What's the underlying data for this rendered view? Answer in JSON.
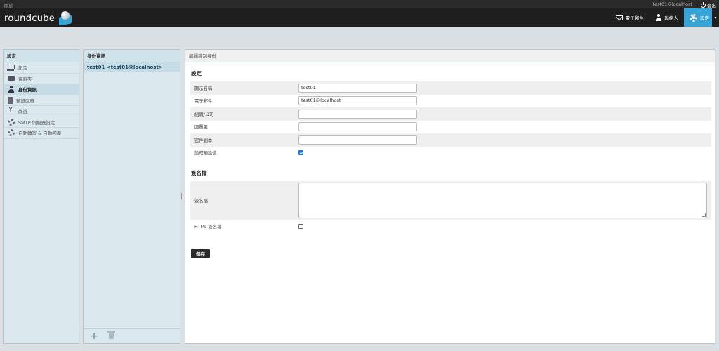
{
  "topbar": {
    "about": "關於",
    "user": "test01@localhost",
    "logout": "登出"
  },
  "header": {
    "logo_text": "roundcube",
    "nav": [
      {
        "label": "電子郵件",
        "icon": "mail-icon"
      },
      {
        "label": "聯絡人",
        "icon": "contacts-icon"
      },
      {
        "label": "設定",
        "icon": "gear-icon",
        "active": true
      }
    ],
    "accent": "#37a4d8"
  },
  "settings_panel": {
    "title": "設定",
    "items": [
      {
        "label": "設定",
        "icon": "monitor-icon"
      },
      {
        "label": "資料夾",
        "icon": "folder-icon"
      },
      {
        "label": "身份資訊",
        "icon": "user-icon",
        "selected": true
      },
      {
        "label": "預設回應",
        "icon": "document-icon"
      },
      {
        "label": "篩選",
        "icon": "filter-icon"
      },
      {
        "label": "SMTP 伺服器設定",
        "icon": "gear-icon"
      },
      {
        "label": "自動轉寄 & 自動回覆",
        "icon": "gear-icon"
      }
    ]
  },
  "identities_panel": {
    "title": "身份資訊",
    "items": [
      {
        "label": "test01 <test01@localhost>"
      }
    ]
  },
  "edit_panel": {
    "title": "編輯識別身份",
    "settings_section": "設定",
    "fields": {
      "display_name": {
        "label": "顯示名稱",
        "value": "test01"
      },
      "email": {
        "label": "電子郵件",
        "value": "test01@localhost"
      },
      "organization": {
        "label": "組織/公司",
        "value": ""
      },
      "reply_to": {
        "label": "回覆至",
        "value": ""
      },
      "bcc": {
        "label": "密件副本",
        "value": ""
      },
      "set_default": {
        "label": "設成預設值",
        "checked": true
      }
    },
    "signature_section": "簽名檔",
    "signature": {
      "label": "簽名檔",
      "value": ""
    },
    "html_signature": {
      "label": "HTML 簽名檔",
      "checked": false
    },
    "save_label": "儲存"
  }
}
